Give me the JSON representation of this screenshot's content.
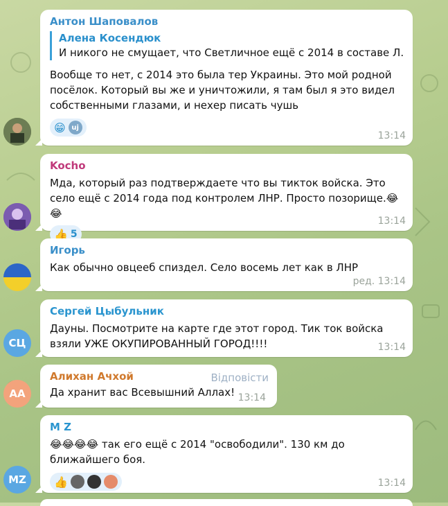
{
  "messages": [
    {
      "author": "Антон Шаповалов",
      "reply_author": "Алена Косендюк",
      "reply_text": "И никого не смущает, что Светличное ещё с 2014 в составе Л...",
      "text": "Вообще то нет, с 2014 это была тер Украины. Это мой родной посёлок. Который вы же и уничтожили, я там был я это видел собственными глазами, и нехер писать чушь",
      "reaction_emoji": "😁",
      "reaction_user": "uj",
      "time": "13:14"
    },
    {
      "author": "Kocho",
      "text": "Мда, который раз подтверждаете что вы тикток войска. Это село ещё с 2014 года под контролем ЛНР. Просто позорище.😂😂",
      "reaction_emoji": "👍",
      "reaction_count": "5",
      "time": "13:14"
    },
    {
      "author": "Игорь",
      "text": "Как обычно овцееб спиздел. Село восемь лет как в ЛНР",
      "time": "ред. 13:14"
    },
    {
      "author": "Сергей Цыбульник",
      "avatar_initials": "СЦ",
      "text": "Дауны. Посмотрите на карте где этот город. Тик ток войска взяли УЖЕ ОКУПИРОВАННЫЙ ГОРОД!!!!",
      "time": "13:14"
    },
    {
      "author": "Алихан Ачхой",
      "avatar_initials": "АА",
      "reply_button": "Відповісти",
      "text": "Да хранит вас Всевышний Аллах!",
      "time": "13:14"
    },
    {
      "author": "M Z",
      "avatar_initials": "MZ",
      "text": "😂😂😂😂 так его ещё с 2014 \"освободили\". 130 км до ближайшего боя.",
      "reaction_emoji": "👍",
      "time": "13:14"
    }
  ],
  "colors": {
    "author1": "#3a8fc9",
    "author2": "#c0397a",
    "author3": "#3a8fc9",
    "author4": "#2b95cf",
    "author5": "#d07a2e",
    "author6": "#2b95cf"
  }
}
